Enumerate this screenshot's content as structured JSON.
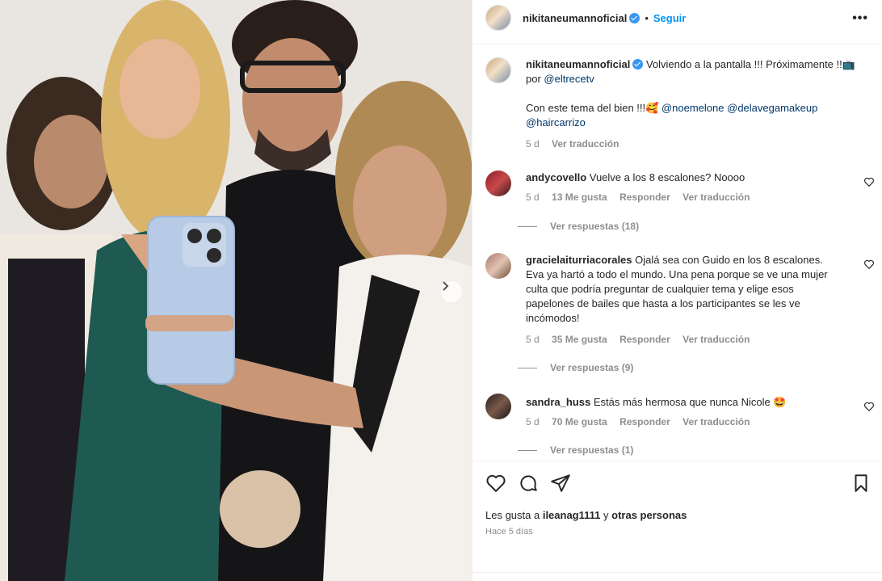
{
  "post": {
    "username": "nikitaneumannoficial",
    "follow_label": "Seguir",
    "more_label": "•••",
    "caption_text_1": "Volviendo a la pantalla !!! Próximamente !!",
    "caption_tv_emoji": "📺",
    "caption_by": " por ",
    "caption_mention_1": "@eltrecetv",
    "caption_text_2": "Con este tema del bien !!!",
    "caption_emoji_2": "🥰",
    "caption_mention_2": "@noemelone",
    "caption_mention_3": "@delavegamakeup",
    "caption_mention_4": "@haircarrizo",
    "caption_time": "5 d",
    "caption_translate": "Ver traducción"
  },
  "comments": [
    {
      "username": "andycovello",
      "text": "Vuelve a los 8 escalones? Noooo",
      "time": "5 d",
      "likes": "13 Me gusta",
      "reply": "Responder",
      "translate": "Ver traducción",
      "view_replies": "Ver respuestas (18)"
    },
    {
      "username": "gracielaiturriacorales",
      "text": "Ojalá sea con Guido en los 8 escalones. Eva ya hartó a todo el mundo. Una pena porque se ve una mujer culta que podría preguntar de cualquier tema y elige esos papelones de bailes que hasta a los participantes se les ve incómodos!",
      "time": "5 d",
      "likes": "35 Me gusta",
      "reply": "Responder",
      "translate": "Ver traducción",
      "view_replies": "Ver respuestas (9)"
    },
    {
      "username": "sandra_huss",
      "text": "Estás más hermosa que nunca Nicole",
      "emoji": "🤩",
      "time": "5 d",
      "likes": "70 Me gusta",
      "reply": "Responder",
      "translate": "Ver traducción",
      "view_replies": "Ver respuestas (1)"
    }
  ],
  "footer": {
    "likes_prefix": "Les gusta a ",
    "likes_user": "ileanag1111",
    "likes_suffix": " y ",
    "likes_others": "otras personas",
    "posted_ago": "Hace 5 días"
  },
  "icons": {
    "like": "heart-icon",
    "comment": "comment-icon",
    "share": "send-icon",
    "save": "bookmark-icon",
    "next": "chevron-right-icon"
  },
  "colors": {
    "link": "#00376b",
    "follow": "#0095f6",
    "verified": "#3897f0",
    "muted": "#8e8e8e"
  }
}
